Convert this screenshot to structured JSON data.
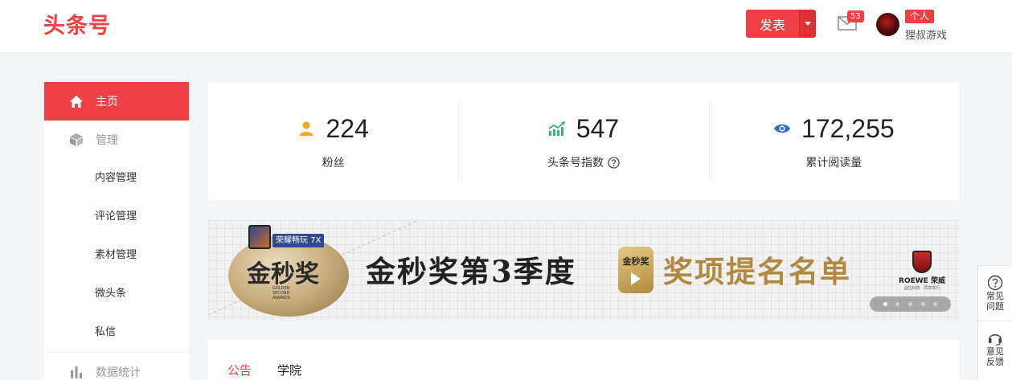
{
  "header": {
    "logo": "头条号",
    "publish_label": "发表",
    "mail_count": "53",
    "account_type": "个人",
    "username": "狸叔游戏"
  },
  "sidebar": {
    "home": "主页",
    "manage": "管理",
    "sub_items": [
      "内容管理",
      "评论管理",
      "素材管理",
      "微头条",
      "私信"
    ],
    "stats": "数据统计"
  },
  "stats": [
    {
      "value": "224",
      "label": "粉丝",
      "icon": "user-icon",
      "color": "#f5a623"
    },
    {
      "value": "547",
      "label": "头条号指数",
      "icon": "trend-up-icon",
      "color": "#3cb371"
    },
    {
      "value": "172,255",
      "label": "累计阅读量",
      "icon": "eye-icon",
      "color": "#2d6be4"
    }
  ],
  "banner": {
    "phone_tag": "荣耀畅玩 7X",
    "medal_text": "金秒奖",
    "medal_small": "GOLDEN SECOND AWARDS",
    "title": "金秒奖第3季度",
    "mid_badge": "金秒奖",
    "subtitle": "奖项提名名单",
    "sponsor": "ROEWE 荣威",
    "sponsor_small": "品位科技 · 同享驾行",
    "slides": 5,
    "active_slide": 1
  },
  "bottom_tabs": [
    "公告",
    "学院"
  ],
  "float_panel": {
    "faq": "常见问题",
    "feedback": "意见反馈"
  },
  "colors": {
    "brand": "#ee4044",
    "gold": "#b08a40"
  }
}
